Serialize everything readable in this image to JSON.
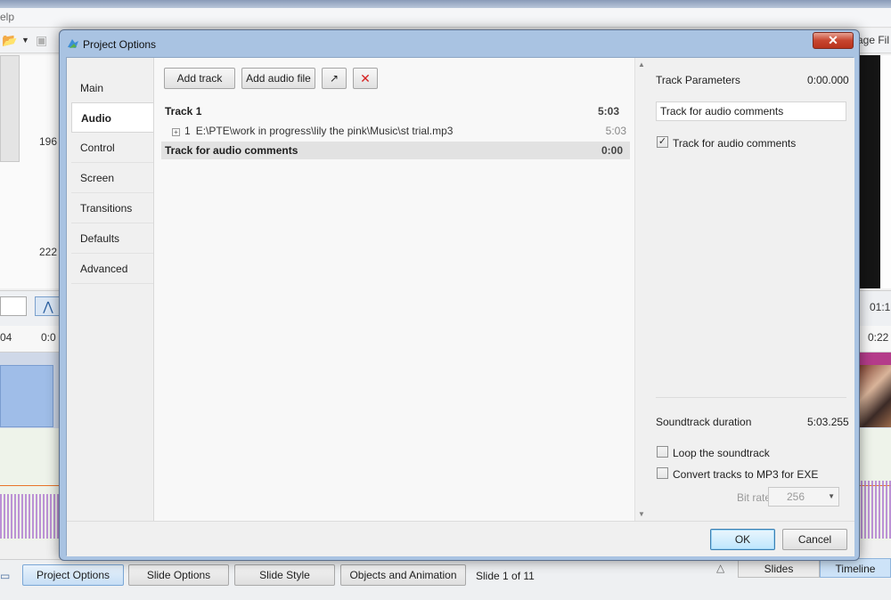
{
  "background": {
    "menu_text": "elp",
    "image_file_label": "age Fil",
    "numbers": [
      "196",
      "222"
    ],
    "time_right": "01:1",
    "ruler_labels": [
      "04",
      "0:0",
      "0:22"
    ],
    "bottom_buttons": [
      "Project Options",
      "Slide Options",
      "Slide Style",
      "Objects and Animation"
    ],
    "slide_counter": "Slide 1 of 11",
    "view_tabs": [
      "Slides",
      "Timeline"
    ],
    "up_arrow": "△"
  },
  "dialog": {
    "title": "Project Options",
    "close_glyph": "✕",
    "nav": [
      "Main",
      "Audio",
      "Control",
      "Screen",
      "Transitions",
      "Defaults",
      "Advanced"
    ],
    "active_nav": "Audio",
    "toolbar": {
      "add_track": "Add track",
      "add_audio_file": "Add audio file",
      "edit_glyph": "↗",
      "delete_glyph": "✕"
    },
    "tracks": [
      {
        "name": "Track 1",
        "duration": "5:03",
        "files": [
          {
            "index": "1",
            "path": "E:\\PTE\\work in progress\\lily the pink\\Music\\st trial.mp3",
            "duration": "5:03"
          }
        ]
      },
      {
        "name": "Track for audio comments",
        "duration": "0:00",
        "files": []
      }
    ],
    "params": {
      "heading": "Track Parameters",
      "time": "0:00.000",
      "track_name_value": "Track for audio comments",
      "comments_checkbox_label": "Track for audio comments",
      "comments_checked": true,
      "soundtrack_duration_label": "Soundtrack duration",
      "soundtrack_duration_value": "5:03.255",
      "loop_label": "Loop the soundtrack",
      "loop_checked": false,
      "convert_label": "Convert tracks to MP3 for EXE",
      "convert_checked": false,
      "bitrate_label": "Bit rate",
      "bitrate_value": "256"
    },
    "footer": {
      "ok": "OK",
      "cancel": "Cancel"
    }
  },
  "colors": {
    "titlebar": "#a9c3e2",
    "close": "#c7452f",
    "ok_border": "#3c7fb1"
  }
}
